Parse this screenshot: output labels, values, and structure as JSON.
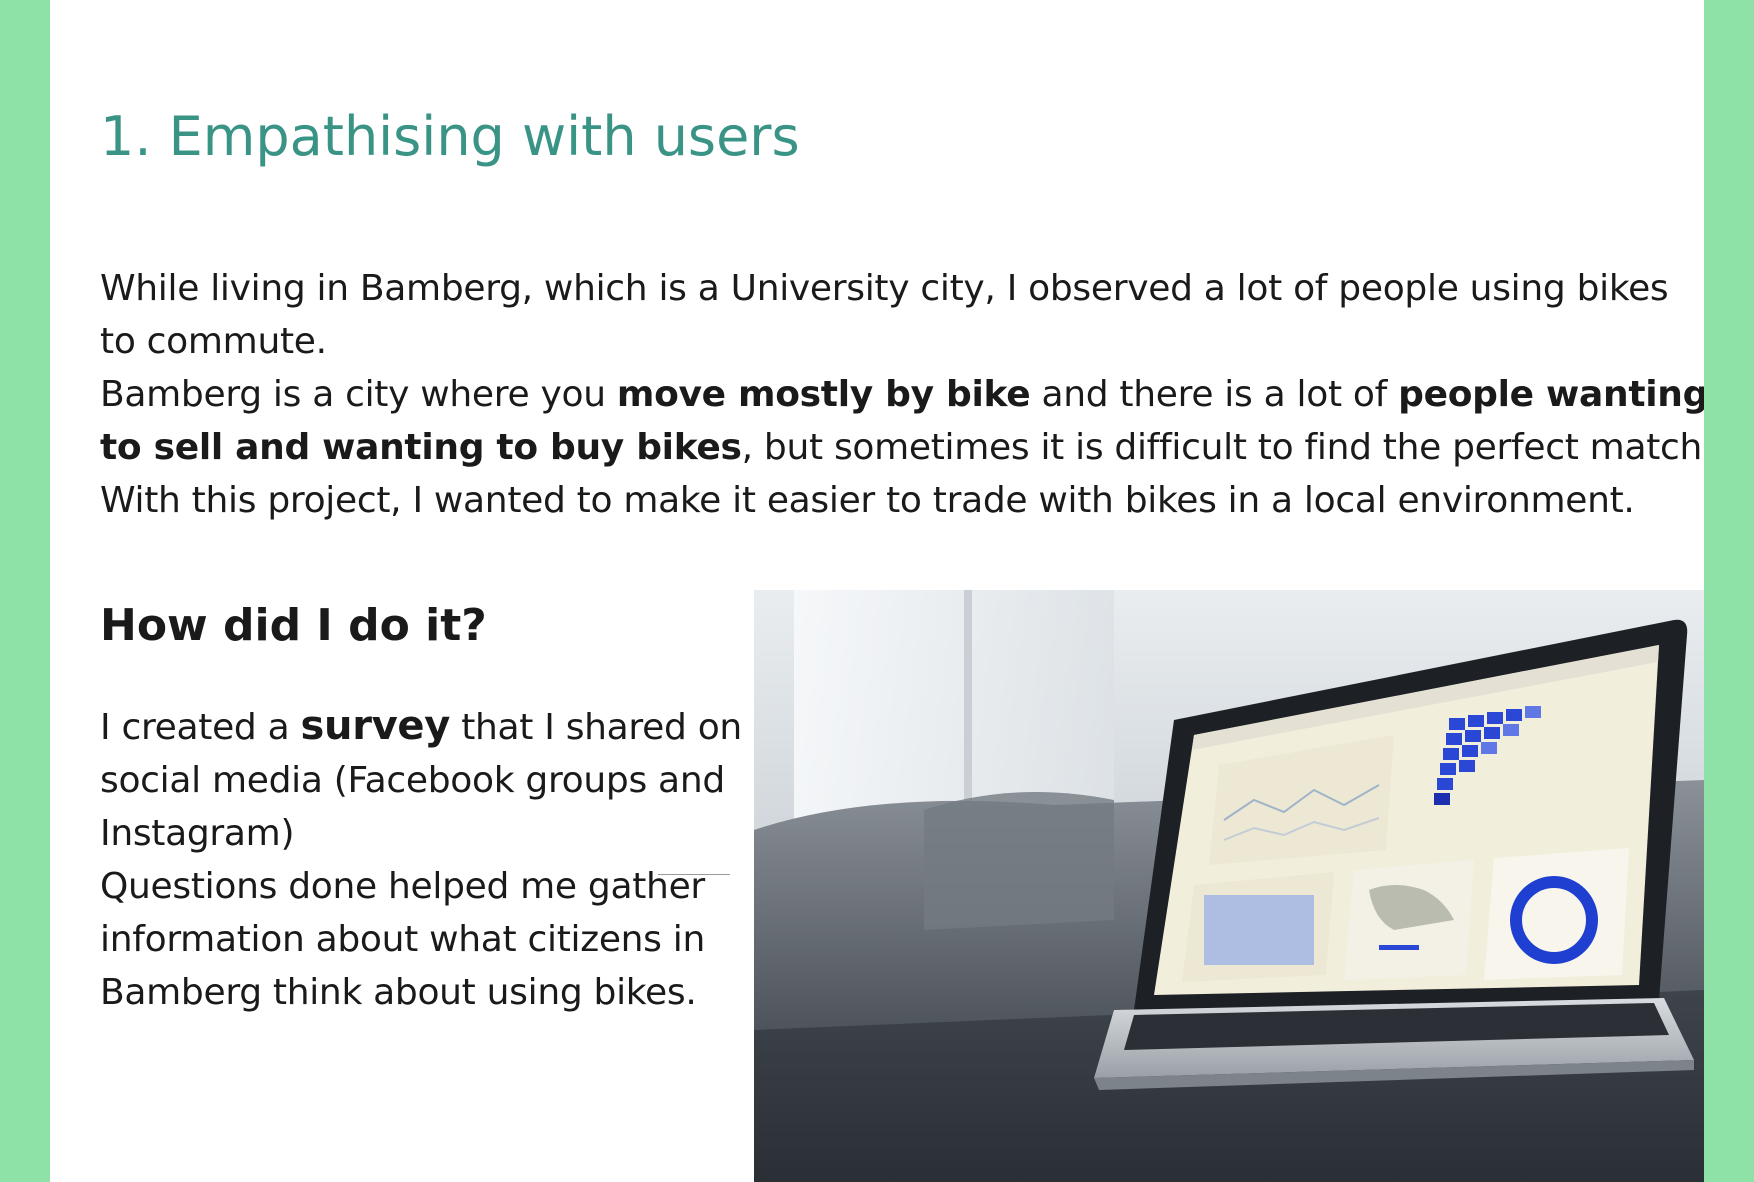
{
  "title": "1. Empathising with users",
  "intro": {
    "l1": "While living in Bamberg, which is a University city, I observed a lot of people using bikes",
    "l2": "to commute.",
    "l3a": "Bamberg is a city where you ",
    "l3b": "move mostly by bike",
    "l3c": " and there is a lot of ",
    "l3d": "people wanting",
    "l4a": "to sell and wanting to buy bikes",
    "l4b": ", but sometimes it is difficult to find the perfect match.",
    "l5": "With this project, I wanted to make it easier to trade with bikes in a local environment."
  },
  "subhead": "How did I do it?",
  "method": {
    "l1a": "I created a ",
    "l1b": "survey",
    "l1c": " that I shared on",
    "l2": "social media (Facebook groups and",
    "l3": "Instagram)",
    "l4": "Questions done helped me gather",
    "l5": "information about what citizens in",
    "l6": "Bamberg think about using bikes."
  },
  "colors": {
    "side_band": "#8ee2a8",
    "title": "#3a9486",
    "text": "#1a1a1a"
  }
}
